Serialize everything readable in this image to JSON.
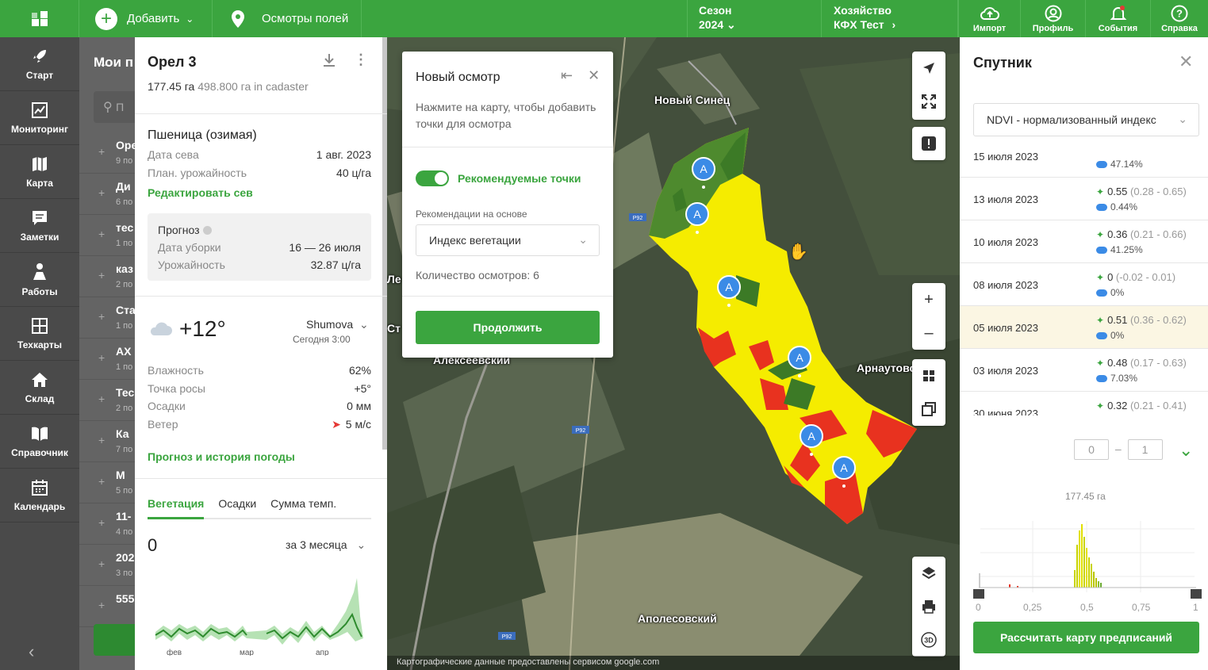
{
  "topbar": {
    "add_label": "Добавить",
    "inspections_label": "Осмотры полей",
    "season_label": "Сезон",
    "season_value": "2024",
    "farm_label": "Хозяйство",
    "farm_value": "КФХ Тест",
    "buttons": [
      "Импорт",
      "Профиль",
      "События",
      "Справка"
    ]
  },
  "nav": {
    "items": [
      "Старт",
      "Мониторинг",
      "Карта",
      "Заметки",
      "Работы",
      "Техкарты",
      "Склад",
      "Справочник",
      "Календарь"
    ]
  },
  "field_list": {
    "title": "Мои п",
    "search_placeholder": "П",
    "rows": [
      {
        "name": "Оре",
        "sub": "9 по"
      },
      {
        "name": "Ди",
        "sub": "6 по"
      },
      {
        "name": "тес",
        "sub": "1 по"
      },
      {
        "name": "каз",
        "sub": "2 по"
      },
      {
        "name": "Ста",
        "sub": "1 по"
      },
      {
        "name": "АХ",
        "sub": "1 по"
      },
      {
        "name": "Тес",
        "sub": "2 по"
      },
      {
        "name": "Ка",
        "sub": "7 по"
      },
      {
        "name": "М",
        "sub": "5 по"
      },
      {
        "name": "11-",
        "sub": "4 по"
      },
      {
        "name": "202",
        "sub": "3 по"
      },
      {
        "name": "555",
        "sub": ""
      }
    ]
  },
  "field": {
    "title": "Орел 3",
    "area": "177.45 га",
    "cadastre": "498.800 га in cadaster",
    "crop": "Пшеница (озимая)",
    "sowing_label": "Дата сева",
    "sowing_value": "1 авг. 2023",
    "yield_plan_label": "План. урожайность",
    "yield_plan_value": "40 ц/га",
    "edit_sowing_link": "Редактировать сев",
    "forecast": {
      "title": "Прогноз",
      "harvest_label": "Дата уборки",
      "harvest_value": "16 — 26 июля",
      "yield_label": "Урожайность",
      "yield_value": "32.87 ц/га"
    },
    "weather": {
      "temp": "+12°",
      "location": "Shumova",
      "time": "Сегодня 3:00",
      "humidity_label": "Влажность",
      "humidity_value": "62%",
      "dew_label": "Точка росы",
      "dew_value": "+5°",
      "precip_label": "Осадки",
      "precip_value": "0 мм",
      "wind_label": "Ветер",
      "wind_value": "5 м/с",
      "history_link": "Прогноз и история погоды"
    },
    "tabs": [
      "Вегетация",
      "Осадки",
      "Сумма темп."
    ],
    "veg_value": "0",
    "period": "за 3 месяца",
    "chart_months": [
      "фев",
      "мар",
      "апр"
    ]
  },
  "map": {
    "labels": [
      "Новый Синец",
      "Алексеевский",
      "Арнаутово",
      "Аполесовский",
      "Ле",
      "Ст"
    ],
    "road_labels": [
      "Р92",
      "Р92",
      "Р92"
    ],
    "credit": "Картографические данные предоставлены сервисом google.com",
    "pin_letter": "A"
  },
  "inspection": {
    "title": "Новый осмотр",
    "hint": "Нажмите на карту, чтобы добавить точки для осмотра",
    "toggle_label": "Рекомендуемые точки",
    "based_on_label": "Рекомендации на основе",
    "based_on_value": "Индекс вегетации",
    "count_label": "Количество осмотров: 6",
    "continue_label": "Продолжить"
  },
  "satellite": {
    "title": "Спутник",
    "index_select": "NDVI - нормализованный индекс",
    "rows": [
      {
        "date": "15 июля 2023",
        "ndvi": "",
        "range": "",
        "cloud": "47.14%"
      },
      {
        "date": "13 июля 2023",
        "ndvi": "0.55",
        "range": "(0.28 - 0.65)",
        "cloud": "0.44%"
      },
      {
        "date": "10 июля 2023",
        "ndvi": "0.36",
        "range": "(0.21 - 0.66)",
        "cloud": "41.25%"
      },
      {
        "date": "08 июля 2023",
        "ndvi": "0",
        "range": "(-0.02 - 0.01)",
        "cloud": "0%"
      },
      {
        "date": "05 июля 2023",
        "ndvi": "0.51",
        "range": "(0.36 - 0.62)",
        "cloud": "0%"
      },
      {
        "date": "03 июля 2023",
        "ndvi": "0.48",
        "range": "(0.17 - 0.63)",
        "cloud": "7.03%"
      },
      {
        "date": "30 июня 2023",
        "ndvi": "0.32",
        "range": "(0.21 - 0.41)",
        "cloud": ""
      }
    ],
    "range_min": "0",
    "range_max": "1",
    "hist_area": "177.45 га",
    "hist_ticks": [
      "0",
      "0,25",
      "0,5",
      "0,75",
      "1"
    ],
    "calc_button": "Рассчитать карту предписаний"
  }
}
